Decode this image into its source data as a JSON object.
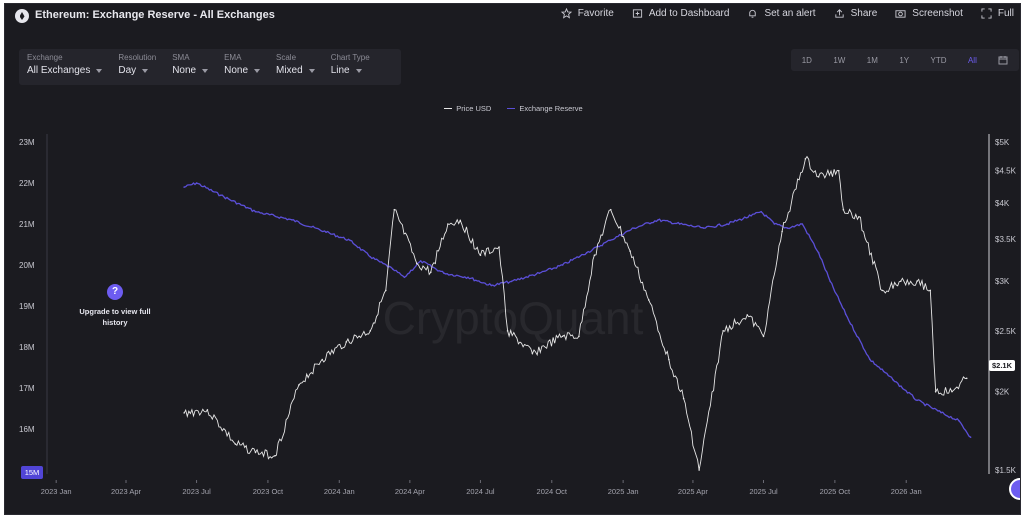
{
  "header": {
    "title": "Ethereum: Exchange Reserve - All Exchanges",
    "actions": [
      {
        "label": "Favorite",
        "icon": "star-icon"
      },
      {
        "label": "Add to Dashboard",
        "icon": "dashboard-icon"
      },
      {
        "label": "Set an alert",
        "icon": "bell-icon"
      },
      {
        "label": "Share",
        "icon": "share-icon"
      },
      {
        "label": "Screenshot",
        "icon": "camera-icon"
      },
      {
        "label": "Full",
        "icon": "fullscreen-icon"
      }
    ]
  },
  "controls": [
    {
      "label": "Exchange",
      "value": "All Exchanges"
    },
    {
      "label": "Resolution",
      "value": "Day"
    },
    {
      "label": "SMA",
      "value": "None"
    },
    {
      "label": "EMA",
      "value": "None"
    },
    {
      "label": "Scale",
      "value": "Mixed"
    },
    {
      "label": "Chart Type",
      "value": "Line"
    }
  ],
  "ranges": {
    "items": [
      "1D",
      "1W",
      "1M",
      "1Y",
      "YTD",
      "All"
    ],
    "active": "All"
  },
  "upgrade": {
    "text_line1": "Upgrade to view full",
    "text_line2": "history",
    "icon": "?"
  },
  "current_price_label": "$2.1K",
  "left_axis_marker": "15M",
  "watermark": "CryptoQuant",
  "colors": {
    "background": "#1b1b20",
    "price": "#e6e6e6",
    "reserve": "#5b4fd8",
    "accent": "#6d5cf0"
  },
  "chart_data": {
    "type": "line",
    "legend_position": "top-center",
    "grid": false,
    "series": [
      {
        "name": "Price USD",
        "axis": "right",
        "color": "#e6e6e6",
        "x": [
          "2023-06-15",
          "2023-07-15",
          "2023-08-20",
          "2023-09-15",
          "2023-10-10",
          "2023-11-10",
          "2023-12-10",
          "2024-01-10",
          "2024-02-10",
          "2024-03-01",
          "2024-03-12",
          "2024-04-10",
          "2024-04-28",
          "2024-05-20",
          "2024-06-05",
          "2024-07-01",
          "2024-07-25",
          "2024-08-05",
          "2024-09-06",
          "2024-10-15",
          "2024-11-05",
          "2024-11-25",
          "2024-12-16",
          "2025-01-10",
          "2025-02-03",
          "2025-03-01",
          "2025-03-20",
          "2025-04-09",
          "2025-05-10",
          "2025-06-10",
          "2025-07-01",
          "2025-07-25",
          "2025-08-24",
          "2025-09-10",
          "2025-10-06",
          "2025-10-12",
          "2025-11-01",
          "2025-12-01",
          "2025-12-25",
          "2026-01-15",
          "2026-02-01",
          "2026-02-08",
          "2026-03-01",
          "2026-03-20"
        ],
        "values": [
          1850,
          1870,
          1650,
          1600,
          1580,
          2050,
          2250,
          2400,
          2500,
          2900,
          3900,
          3200,
          3100,
          3700,
          3750,
          3300,
          3400,
          2500,
          2300,
          2450,
          2450,
          3300,
          3900,
          3350,
          2800,
          2250,
          1950,
          1500,
          2500,
          2650,
          2450,
          3600,
          4700,
          4400,
          4500,
          3900,
          3800,
          2900,
          3000,
          3000,
          2900,
          2000,
          2000,
          2100
        ]
      },
      {
        "name": "Exchange Reserve",
        "axis": "left",
        "color": "#5b4fd8",
        "x": [
          "2023-06-15",
          "2023-07-01",
          "2023-08-01",
          "2023-09-15",
          "2023-11-01",
          "2023-12-15",
          "2024-01-15",
          "2024-02-10",
          "2024-03-10",
          "2024-03-25",
          "2024-04-15",
          "2024-05-15",
          "2024-06-15",
          "2024-07-15",
          "2024-08-10",
          "2024-09-15",
          "2024-10-15",
          "2024-11-15",
          "2024-12-15",
          "2025-01-15",
          "2025-02-15",
          "2025-03-15",
          "2025-04-15",
          "2025-05-15",
          "2025-06-15",
          "2025-06-28",
          "2025-07-15",
          "2025-08-01",
          "2025-08-20",
          "2025-09-10",
          "2025-09-25",
          "2025-10-15",
          "2025-11-15",
          "2025-12-15",
          "2026-01-15",
          "2026-02-15",
          "2026-03-10",
          "2026-03-25"
        ],
        "values": [
          21.9,
          22.0,
          21.7,
          21.3,
          21.1,
          20.8,
          20.6,
          20.2,
          19.9,
          19.7,
          20.1,
          19.8,
          19.7,
          19.5,
          19.6,
          19.8,
          20.0,
          20.3,
          20.6,
          20.9,
          21.1,
          21.0,
          20.9,
          21.0,
          21.2,
          21.3,
          21.0,
          20.9,
          21.0,
          20.3,
          19.6,
          18.8,
          17.7,
          17.2,
          16.7,
          16.4,
          16.2,
          15.8
        ]
      }
    ],
    "x_ticks": [
      "2023 Jan",
      "2023 Apr",
      "2023 Jul",
      "2023 Oct",
      "2024 Jan",
      "2024 Apr",
      "2024 Jul",
      "2024 Oct",
      "2025 Jan",
      "2025 Apr",
      "2025 Jul",
      "2025 Oct",
      "2026 Jan"
    ],
    "x_tick_dates": [
      "2023-01-01",
      "2023-04-01",
      "2023-07-01",
      "2023-10-01",
      "2024-01-01",
      "2024-04-01",
      "2024-07-01",
      "2024-10-01",
      "2025-01-01",
      "2025-04-01",
      "2025-07-01",
      "2025-10-01",
      "2026-01-01"
    ],
    "xlim": [
      "2022-12-15",
      "2026-04-10"
    ],
    "y_left": {
      "ticks": [
        {
          "v": 23,
          "label": "23M"
        },
        {
          "v": 22,
          "label": "22M"
        },
        {
          "v": 21,
          "label": "21M"
        },
        {
          "v": 20,
          "label": "20M"
        },
        {
          "v": 19,
          "label": "19M"
        },
        {
          "v": 18,
          "label": "18M"
        },
        {
          "v": 17,
          "label": "17M"
        },
        {
          "v": 16,
          "label": "16M"
        }
      ],
      "range": [
        15,
        23
      ],
      "unit": "M"
    },
    "y_right": {
      "ticks": [
        {
          "v": 5000,
          "label": "$5K"
        },
        {
          "v": 4500,
          "label": "$4.5K"
        },
        {
          "v": 4000,
          "label": "$4K"
        },
        {
          "v": 3500,
          "label": "$3.5K"
        },
        {
          "v": 3000,
          "label": "$3K"
        },
        {
          "v": 2500,
          "label": "$2.5K"
        },
        {
          "v": 2000,
          "label": "$2K"
        },
        {
          "v": 1500,
          "label": "$1.5K"
        }
      ],
      "scale": "log"
    }
  }
}
